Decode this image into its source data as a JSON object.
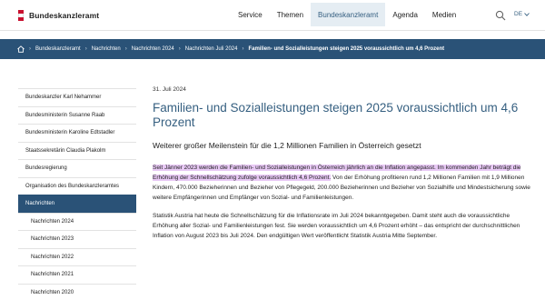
{
  "header": {
    "logo_text": "Bundeskanzleramt",
    "nav": [
      {
        "label": "Service"
      },
      {
        "label": "Themen"
      },
      {
        "label": "Bundeskanzleramt",
        "active": true
      },
      {
        "label": "Agenda"
      },
      {
        "label": "Medien"
      }
    ],
    "language": "DE",
    "icons": [
      "search-icon",
      "chevron-down-icon"
    ]
  },
  "breadcrumb": {
    "icon": "home-icon",
    "items": [
      "Bundeskanzleramt",
      "Nachrichten",
      "Nachrichten 2024",
      "Nachrichten Juli 2024",
      "Familien- und Sozialleistungen steigen 2025 voraussichtlich um 4,6 Prozent"
    ]
  },
  "sidebar": {
    "items": [
      {
        "label": "Bundeskanzler Karl Nehammer"
      },
      {
        "label": "Bundesministerin Susanne Raab"
      },
      {
        "label": "Bundesministerin Karoline Edtstadler"
      },
      {
        "label": "Staatssekretärin Claudia Plakolm"
      },
      {
        "label": "Bundesregierung"
      },
      {
        "label": "Organisation des Bundeskanzleramtes"
      },
      {
        "label": "Nachrichten",
        "active": true
      },
      {
        "label": "Nachrichten 2024",
        "sub": true
      },
      {
        "label": "Nachrichten 2023",
        "sub": true
      },
      {
        "label": "Nachrichten 2022",
        "sub": true
      },
      {
        "label": "Nachrichten 2021",
        "sub": true
      },
      {
        "label": "Nachrichten 2020",
        "sub": true
      }
    ]
  },
  "article": {
    "date": "31. Juli 2024",
    "title": "Familien- und Sozialleistungen steigen 2025 voraussichtlich um 4,6 Prozent",
    "subtitle": "Weiterer großer Meilenstein für die 1,2 Millionen Familien in Österreich gesetzt",
    "lead_highlighted": "Seit Jänner 2023 werden die Familien- und Sozialleistungen in Österreich jährlich an die Inflation angepasst. Im kommenden Jahr beträgt die Erhöhung der Schnellschätzung zufolge voraussichtlich 4,6 Prozent.",
    "lead_rest": " Von der Erhöhung profitieren rund 1,2 Millionen Familien mit 1,9 Millionen Kindern, 470.000 Bezieherinnen und Bezieher von Pflegegeld, 200.000 Bezieherinnen und Bezieher von Sozialhilfe und Mindestsicherung sowie weitere Empfängerinnen und Empfänger von Sozial- und Familienleistungen.",
    "paragraph": "Statistik Austria hat heute die Schnellschätzung für die Inflationsrate im Juli 2024 bekanntgegeben. Damit steht auch die voraussichtliche Erhöhung aller Sozial- und Familienleistungen fest. Sie werden voraussichtlich um 4,6 Prozent erhöht – das entspricht der durchschnittlichen Inflation von August 2023 bis Juli 2024. Den endgültigen Wert veröffentlicht Statistik Austria Mitte September."
  },
  "colors": {
    "brand_blue": "#2a5277",
    "title_blue": "#355f80",
    "highlight": "#e8c9f5",
    "nav_active_bg": "#e5edf3"
  }
}
